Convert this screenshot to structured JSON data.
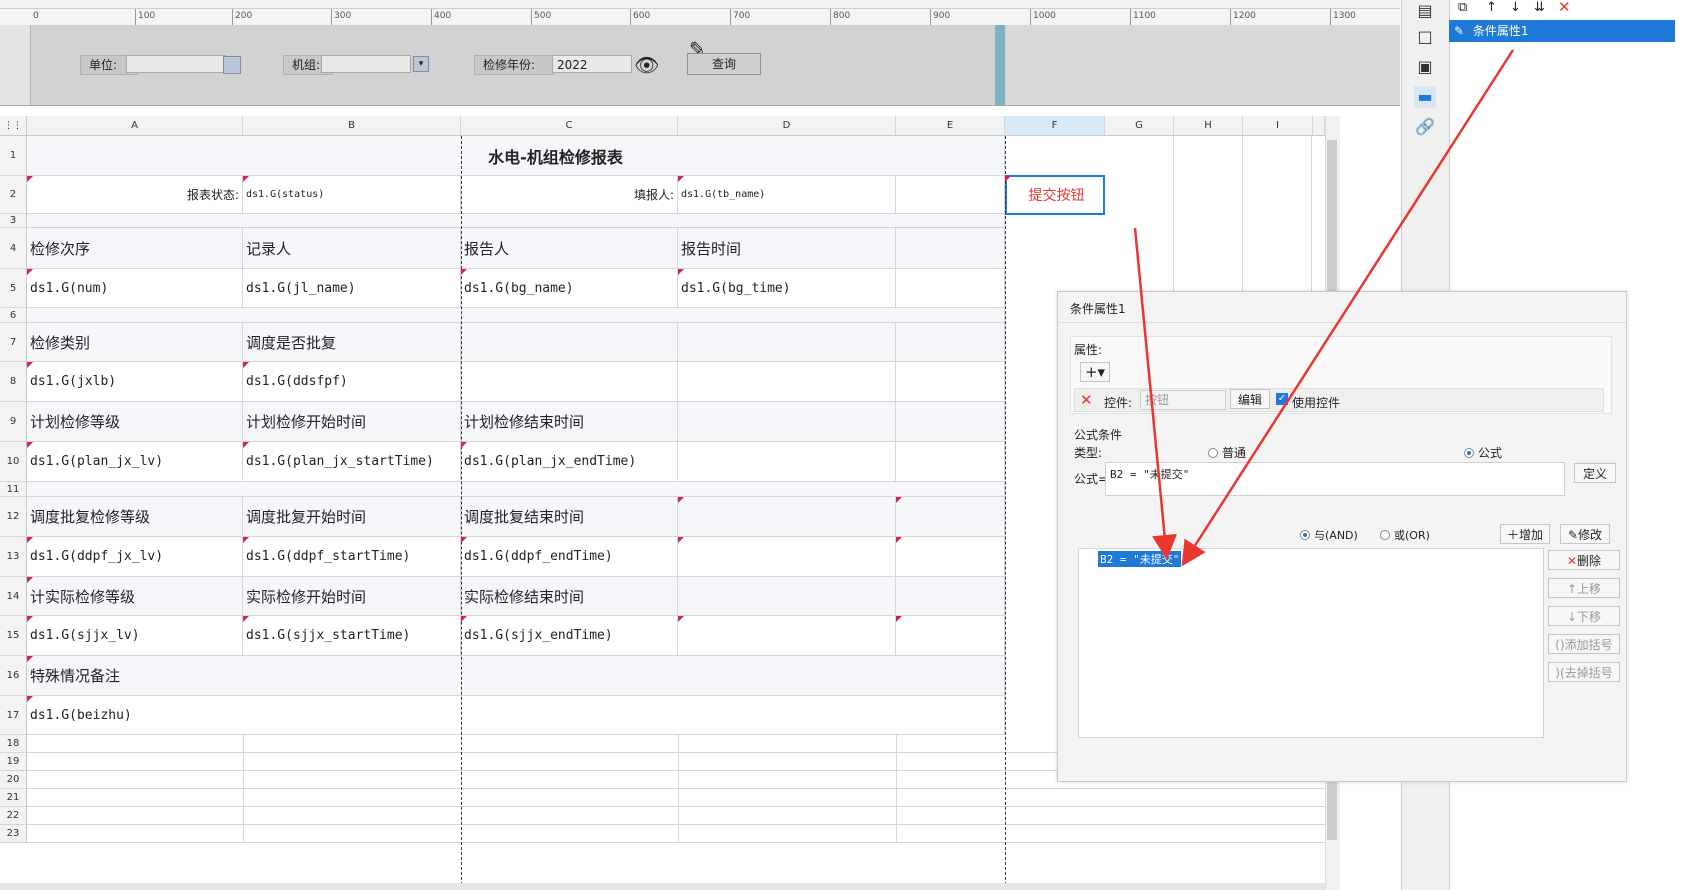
{
  "ruler": {
    "ticks": [
      "0",
      "100",
      "200",
      "300",
      "400",
      "500",
      "600",
      "700",
      "800",
      "900",
      "1000",
      "1100",
      "1200",
      "1300"
    ]
  },
  "params": {
    "unit_label": "单位:",
    "unit_value": "",
    "group_label": "机组:",
    "group_value": "",
    "year_label": "检修年份:",
    "year_value": "2022",
    "query_button": "查询"
  },
  "columns": [
    "A",
    "B",
    "C",
    "D",
    "E",
    "F",
    "G",
    "H",
    "I"
  ],
  "rows": [
    "1",
    "2",
    "3",
    "4",
    "5",
    "6",
    "7",
    "8",
    "9",
    "10",
    "11",
    "12",
    "13",
    "14",
    "15",
    "16",
    "17",
    "18",
    "19",
    "20",
    "21",
    "22",
    "23"
  ],
  "sheet": {
    "title": "水电-机组检修报表",
    "r2": {
      "status_label": "报表状态:",
      "status_value": "ds1.G(status)",
      "filler_label": "填报人:",
      "filler_value": "ds1.G(tb_name)",
      "submit_button": "提交按钮"
    },
    "r4": [
      "检修次序",
      "记录人",
      "报告人",
      "报告时间"
    ],
    "r5": [
      "ds1.G(num)",
      "ds1.G(jl_name)",
      "ds1.G(bg_name)",
      "ds1.G(bg_time)"
    ],
    "r7": [
      "检修类别",
      "调度是否批复"
    ],
    "r8": [
      "ds1.G(jxlb)",
      "ds1.G(ddsfpf)"
    ],
    "r9": [
      "计划检修等级",
      "计划检修开始时间",
      "计划检修结束时间"
    ],
    "r10": [
      "ds1.G(plan_jx_lv)",
      "ds1.G(plan_jx_startTime)",
      "ds1.G(plan_jx_endTime)"
    ],
    "r12": [
      "调度批复检修等级",
      "调度批复开始时间",
      "调度批复结束时间"
    ],
    "r13": [
      "ds1.G(ddpf_jx_lv)",
      "ds1.G(ddpf_startTime)",
      "ds1.G(ddpf_endTime)"
    ],
    "r14": [
      "计实际检修等级",
      "实际检修开始时间",
      "实际检修结束时间"
    ],
    "r15": [
      "ds1.G(sjjx_lv)",
      "ds1.G(sjjx_startTime)",
      "ds1.G(sjjx_endTime)"
    ],
    "r16": [
      "特殊情况备注"
    ],
    "r17": [
      "ds1.G(beizhu)"
    ]
  },
  "right_panel": {
    "selected_item": "条件属性1"
  },
  "dialog": {
    "title": "条件属性1",
    "property_label": "属性:",
    "control_label": "控件:",
    "control_value": "按钮",
    "edit_button": "编辑",
    "use_control_label": "使用控件",
    "formula_condition_label": "公式条件",
    "type_label": "类型:",
    "type_normal": "普通",
    "type_formula": "公式",
    "formula_label": "公式=",
    "formula_value": "B2 = \"未提交\"",
    "define_button": "定义",
    "and_label": "与(AND)",
    "or_label": "或(OR)",
    "add_button": "增加",
    "modify_button": "修改",
    "condition_item": "B2 = \"未提交\"",
    "delete_button": "删除",
    "up_button": "上移",
    "down_button": "下移",
    "add_bracket_button": "添加括号",
    "remove_bracket_button": "去掉括号"
  },
  "colors": {
    "accent": "#1e7ad6",
    "arrow": "#e8372f",
    "submit_text": "#e8372f"
  }
}
